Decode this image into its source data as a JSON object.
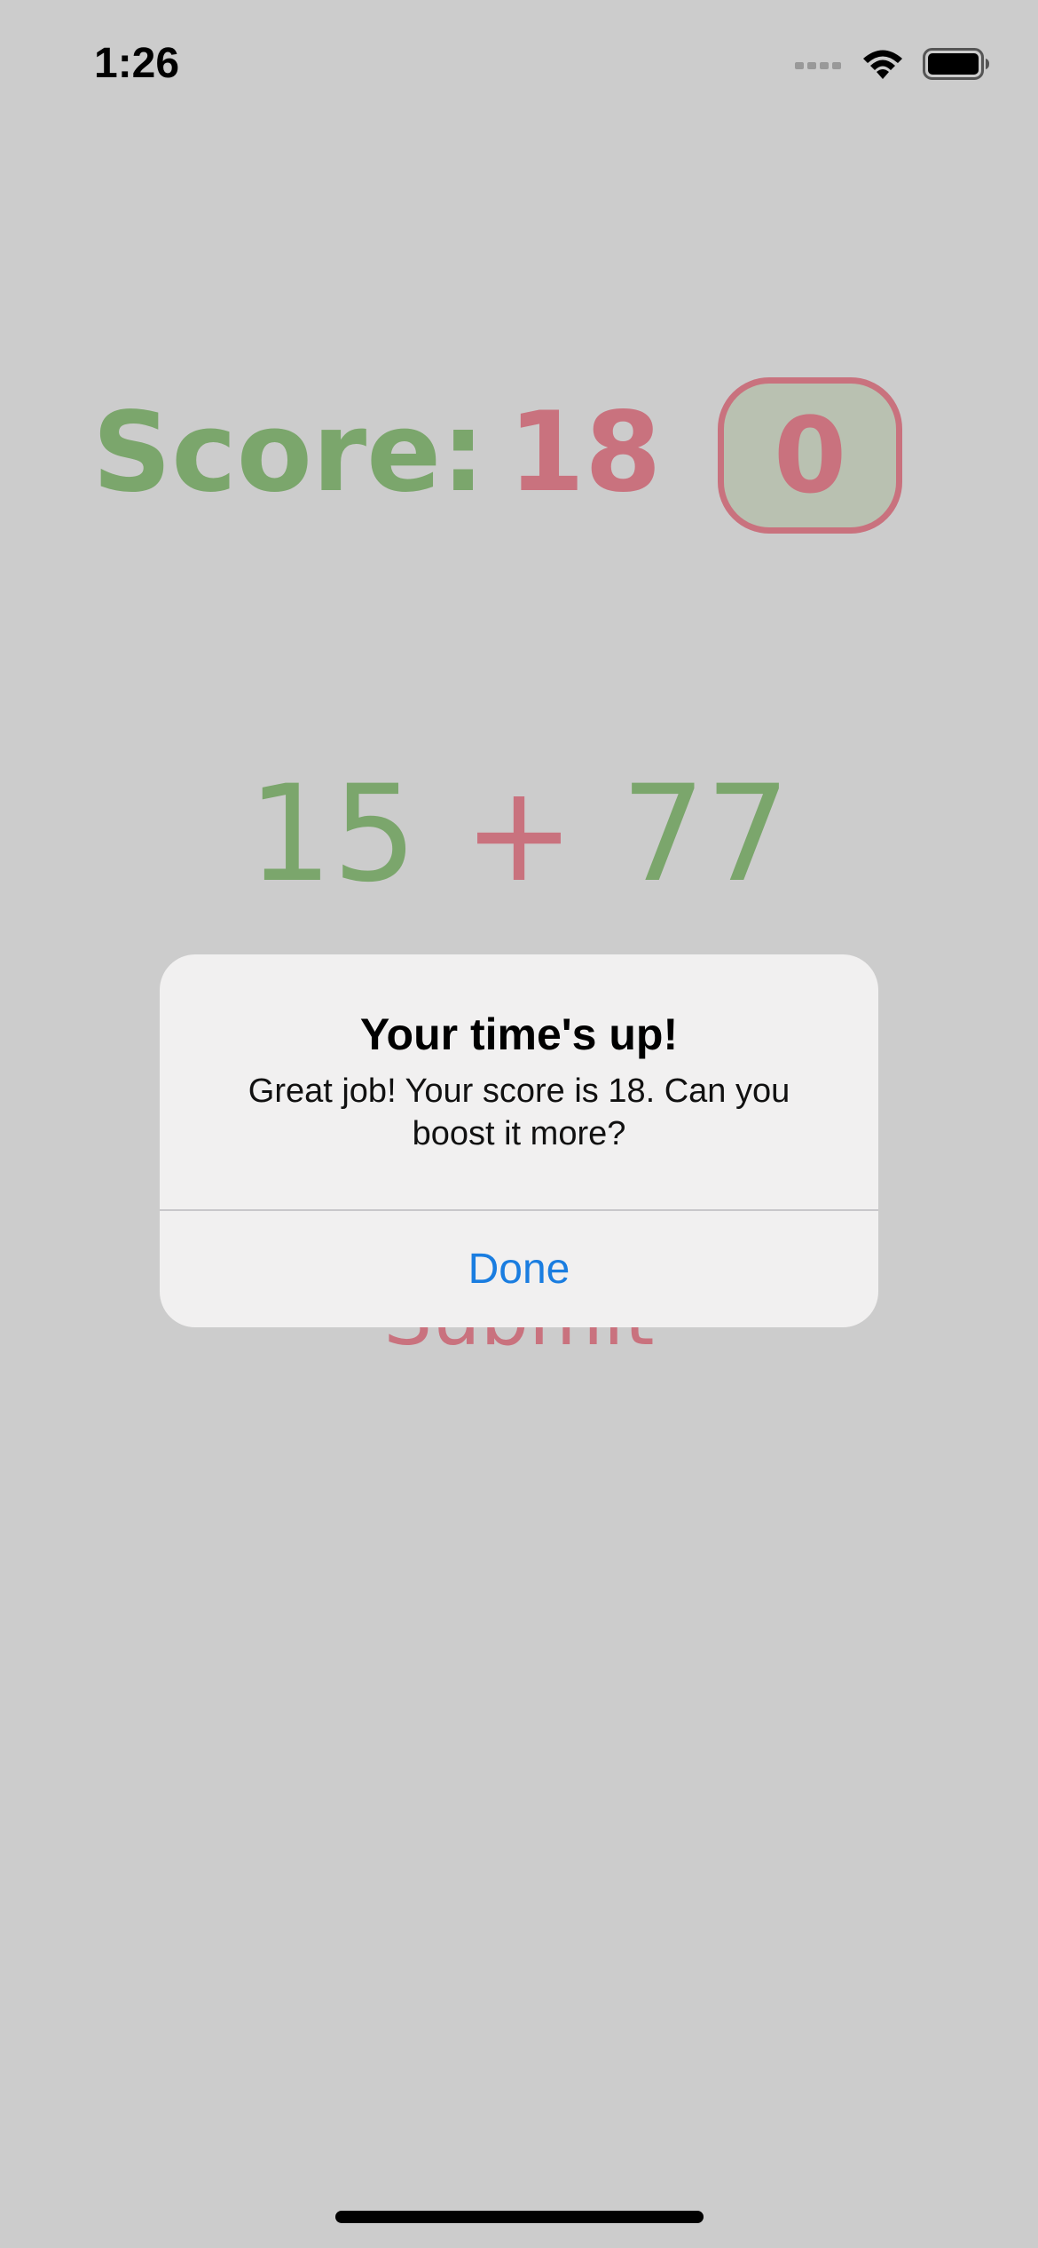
{
  "status_bar": {
    "time": "1:26",
    "icons": [
      "cellular-signal-icon",
      "wifi-icon",
      "battery-icon"
    ]
  },
  "game": {
    "score_label": "Score:",
    "score_value": "18",
    "timer_value": "0",
    "equation": {
      "left_operand": "15",
      "operator": "+",
      "right_operand": "77"
    },
    "submit_label": "Submit"
  },
  "alert": {
    "title": "Your time's up!",
    "message": "Great job! Your score is 18. Can you boost it more?",
    "done_label": "Done"
  },
  "colors": {
    "background": "#cccccc",
    "green": "#7ba66c",
    "pink": "#c9727e",
    "alert_button_blue": "#1a7de0"
  }
}
